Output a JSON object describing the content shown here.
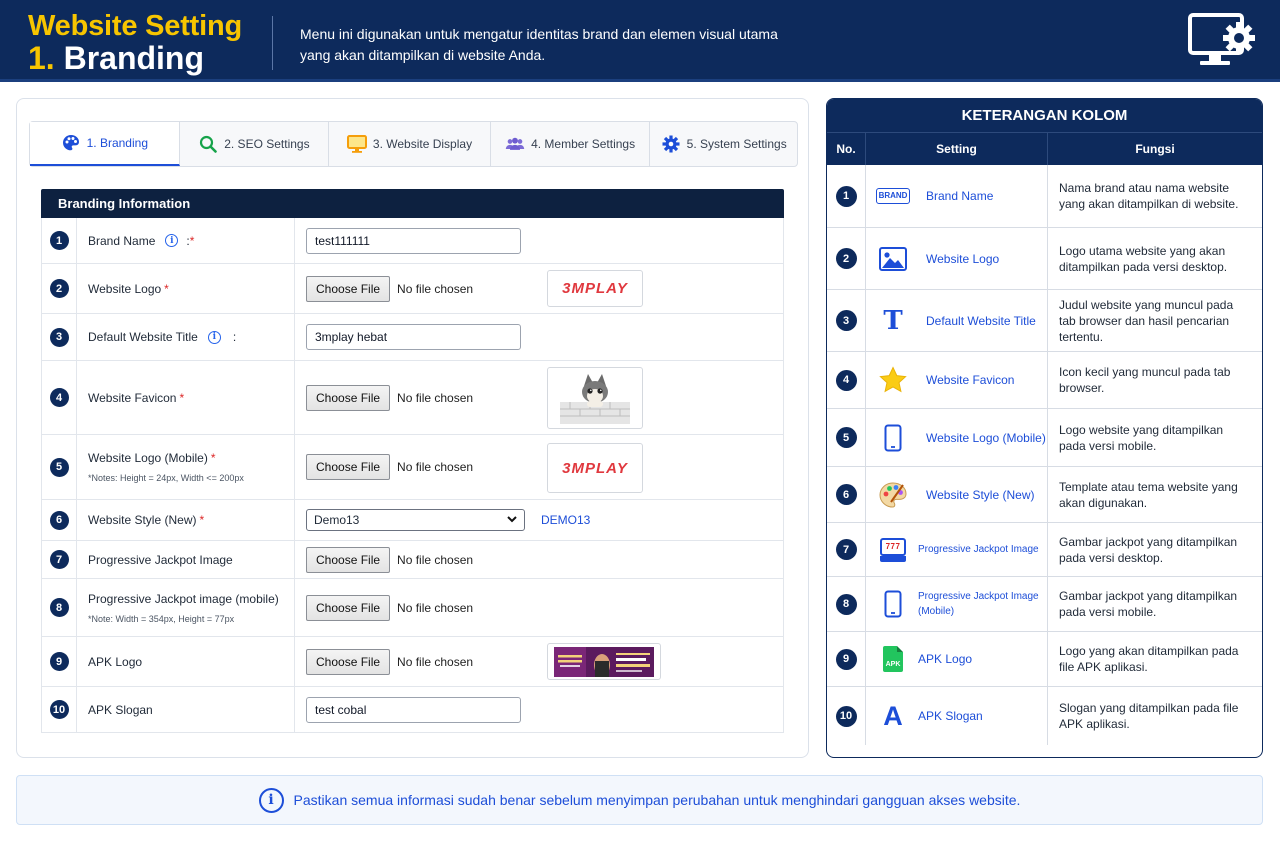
{
  "header": {
    "title_line1": "Website Setting",
    "title_number": "1.",
    "title_line2": "Branding",
    "description": "Menu ini digunakan untuk mengatur identitas brand dan elemen visual utama yang akan ditampilkan di website Anda.",
    "icon": "monitor-gear-icon"
  },
  "tabs": [
    {
      "label": "1. Branding",
      "icon": "palette-icon",
      "active": true
    },
    {
      "label": "2. SEO Settings",
      "icon": "search-icon",
      "active": false
    },
    {
      "label": "3. Website Display",
      "icon": "monitor-icon",
      "active": false
    },
    {
      "label": "4. Member Settings",
      "icon": "users-icon",
      "active": false
    },
    {
      "label": "5. System Settings",
      "icon": "gear-icon",
      "active": false
    }
  ],
  "form": {
    "section_title": "Branding Information",
    "choose_file_label": "Choose File",
    "no_file_label": "No file chosen",
    "rows": [
      {
        "num": "1",
        "label": "Brand Name",
        "colon": ":",
        "required_mark": "*",
        "type": "text",
        "value": "test111111"
      },
      {
        "num": "2",
        "label": "Website Logo",
        "required_mark": "*",
        "type": "file",
        "preview": "3MPLAY"
      },
      {
        "num": "3",
        "label": "Default Website Title",
        "colon": ":",
        "type": "text",
        "value": "3mplay hebat"
      },
      {
        "num": "4",
        "label": "Website Favicon",
        "required_mark": "*",
        "type": "file",
        "preview": "cat-favicon"
      },
      {
        "num": "5",
        "label": "Website Logo (Mobile)",
        "required_mark": "*",
        "note": "*Notes: Height = 24px, Width <= 200px",
        "type": "file",
        "preview": "3MPLAY"
      },
      {
        "num": "6",
        "label": "Website Style (New)",
        "required_mark": "*",
        "type": "select",
        "value": "Demo13",
        "link": "DEMO13"
      },
      {
        "num": "7",
        "label": "Progressive Jackpot Image",
        "type": "file"
      },
      {
        "num": "8",
        "label": "Progressive Jackpot image (mobile)",
        "note": "*Note: Width = 354px, Height = 77px",
        "type": "file"
      },
      {
        "num": "9",
        "label": "APK Logo",
        "type": "file",
        "preview": "apk-banner"
      },
      {
        "num": "10",
        "label": "APK Slogan",
        "type": "text",
        "value": "test cobal"
      }
    ]
  },
  "legend": {
    "title": "KETERANGAN KOLOM",
    "headers": {
      "no": "No.",
      "setting": "Setting",
      "fungsi": "Fungsi"
    },
    "rows": [
      {
        "num": "1",
        "icon": "brand-badge-icon",
        "icon_text": "BRAND",
        "setting": "Brand Name",
        "fungsi": "Nama brand atau nama website yang akan ditampilkan di website."
      },
      {
        "num": "2",
        "icon": "image-icon",
        "setting": "Website Logo",
        "fungsi": "Logo utama website yang akan ditampilkan pada versi desktop."
      },
      {
        "num": "3",
        "icon": "title-t-icon",
        "icon_text": "T",
        "setting": "Default Website Title",
        "fungsi": "Judul website yang muncul pada tab browser dan hasil pencarian tertentu."
      },
      {
        "num": "4",
        "icon": "star-icon",
        "setting": "Website Favicon",
        "fungsi": "Icon kecil yang muncul pada tab browser."
      },
      {
        "num": "5",
        "icon": "mobile-icon",
        "setting": "Website Logo (Mobile)",
        "fungsi": "Logo website yang ditampilkan pada versi mobile."
      },
      {
        "num": "6",
        "icon": "palette-icon",
        "setting": "Website Style (New)",
        "fungsi": "Template atau tema website yang akan digunakan."
      },
      {
        "num": "7",
        "icon": "slot-machine-icon",
        "icon_text": "777",
        "setting": "Progressive Jackpot Image",
        "fungsi": "Gambar jackpot yang ditampilkan pada versi desktop."
      },
      {
        "num": "8",
        "icon": "mobile-icon",
        "setting": "Progressive Jackpot Image (Mobile)",
        "fungsi": "Gambar jackpot yang ditampilkan pada versi mobile."
      },
      {
        "num": "9",
        "icon": "apk-file-icon",
        "icon_text": "APK",
        "setting": "APK Logo",
        "fungsi": "Logo yang akan ditampilkan pada file APK aplikasi."
      },
      {
        "num": "10",
        "icon": "letter-a-icon",
        "icon_text": "A",
        "setting": "APK Slogan",
        "fungsi": "Slogan yang ditampilkan pada file APK aplikasi."
      }
    ]
  },
  "footer": {
    "text": "Pastikan semua informasi sudah benar sebelum menyimpan perubahan untuk menghindari gangguan akses website."
  },
  "colors": {
    "navy": "#0d2a5c",
    "accent_yellow": "#f7c500",
    "link_blue": "#1d4ed8",
    "required_red": "#dc2626"
  }
}
